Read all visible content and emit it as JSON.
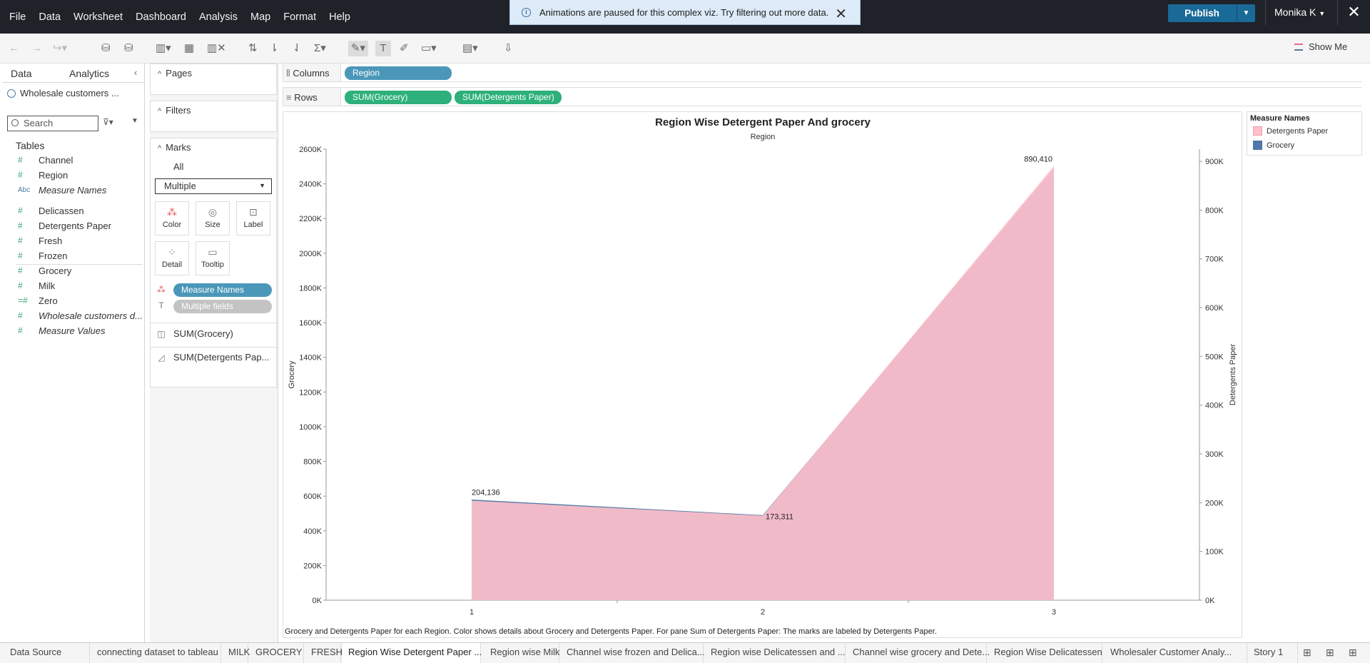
{
  "menu": {
    "items": [
      "File",
      "Data",
      "Worksheet",
      "Dashboard",
      "Analysis",
      "Map",
      "Format",
      "Help"
    ]
  },
  "notification": {
    "text": "Animations are paused for this complex viz. Try filtering out more data."
  },
  "header": {
    "publish": "Publish",
    "user": "Monika K"
  },
  "toolbar": {
    "show_me": "Show Me"
  },
  "left": {
    "tab_data": "Data",
    "tab_analytics": "Analytics",
    "datasource": "Wholesale customers ...",
    "search_placeholder": "Search",
    "tables_label": "Tables",
    "fields": [
      {
        "name": "Channel",
        "type": "#"
      },
      {
        "name": "Region",
        "type": "#"
      },
      {
        "name": "Measure Names",
        "type": "Abc"
      },
      {
        "name": "Delicassen",
        "type": "#"
      },
      {
        "name": "Detergents Paper",
        "type": "#"
      },
      {
        "name": "Fresh",
        "type": "#"
      },
      {
        "name": "Frozen",
        "type": "#"
      },
      {
        "name": "Grocery",
        "type": "#"
      },
      {
        "name": "Milk",
        "type": "#"
      },
      {
        "name": "Zero",
        "type": "=#"
      },
      {
        "name": "Wholesale customers d...",
        "type": "#"
      },
      {
        "name": "Measure Values",
        "type": "#"
      }
    ]
  },
  "cards": {
    "pages": "Pages",
    "filters": "Filters",
    "marks": "Marks",
    "all": "All",
    "mark_type": "Multiple",
    "buttons": [
      "Color",
      "Size",
      "Label",
      "Detail",
      "Tooltip"
    ],
    "pill_color": "Measure Names",
    "pill_label": "Multiple fields",
    "sum_grocery": "SUM(Grocery)",
    "sum_det": "SUM(Detergents Pap..."
  },
  "shelves": {
    "columns_label": "Columns",
    "rows_label": "Rows",
    "col_pill": "Region",
    "row_pill1": "SUM(Grocery)",
    "row_pill2": "SUM(Detergents Paper)"
  },
  "chart_data": {
    "type": "area",
    "title": "Region Wise Detergent Paper And grocery",
    "subtitle": "Region",
    "categories": [
      1,
      2,
      3
    ],
    "series": [
      {
        "name": "Grocery",
        "axis": "left",
        "values": [
          580000,
          490000,
          2490000
        ],
        "color": "#4e79a7"
      },
      {
        "name": "Detergents Paper",
        "axis": "right",
        "values": [
          204136,
          173311,
          890410
        ],
        "color": "#ffc0cb"
      }
    ],
    "data_labels": [
      "204,136",
      "173,311",
      "890,410"
    ],
    "ylabel_left": "Grocery",
    "ylabel_right": "Detergents Paper",
    "ylim_left": [
      0,
      2600000
    ],
    "ylim_right": [
      0,
      925000
    ],
    "yticks_left": [
      "0K",
      "200K",
      "400K",
      "600K",
      "800K",
      "1000K",
      "1200K",
      "1400K",
      "1600K",
      "1800K",
      "2000K",
      "2200K",
      "2400K",
      "2600K"
    ],
    "yticks_right": [
      "0K",
      "100K",
      "200K",
      "300K",
      "400K",
      "500K",
      "600K",
      "700K",
      "800K",
      "900K"
    ],
    "caption": "Grocery and Detergents Paper for each Region.  Color shows details about Grocery and Detergents Paper.  For pane Sum of Detergents Paper:  The marks are labeled by Detergents Paper.",
    "legend_title": "Measure Names",
    "legend": [
      "Detergents Paper",
      "Grocery"
    ]
  },
  "bottom_tabs": [
    "Data Source",
    "connecting dataset to tableau",
    "MILK",
    "GROCERY",
    "FRESH",
    "Region Wise Detergent Paper ...",
    "Region wise Milk",
    "Channel wise frozen and Delica...",
    "Region wise Delicatessen and ...",
    "Channel wise grocery and Dete...",
    "Region Wise Delicatessen",
    "Wholesaler Customer Analy...",
    "Story 1"
  ]
}
